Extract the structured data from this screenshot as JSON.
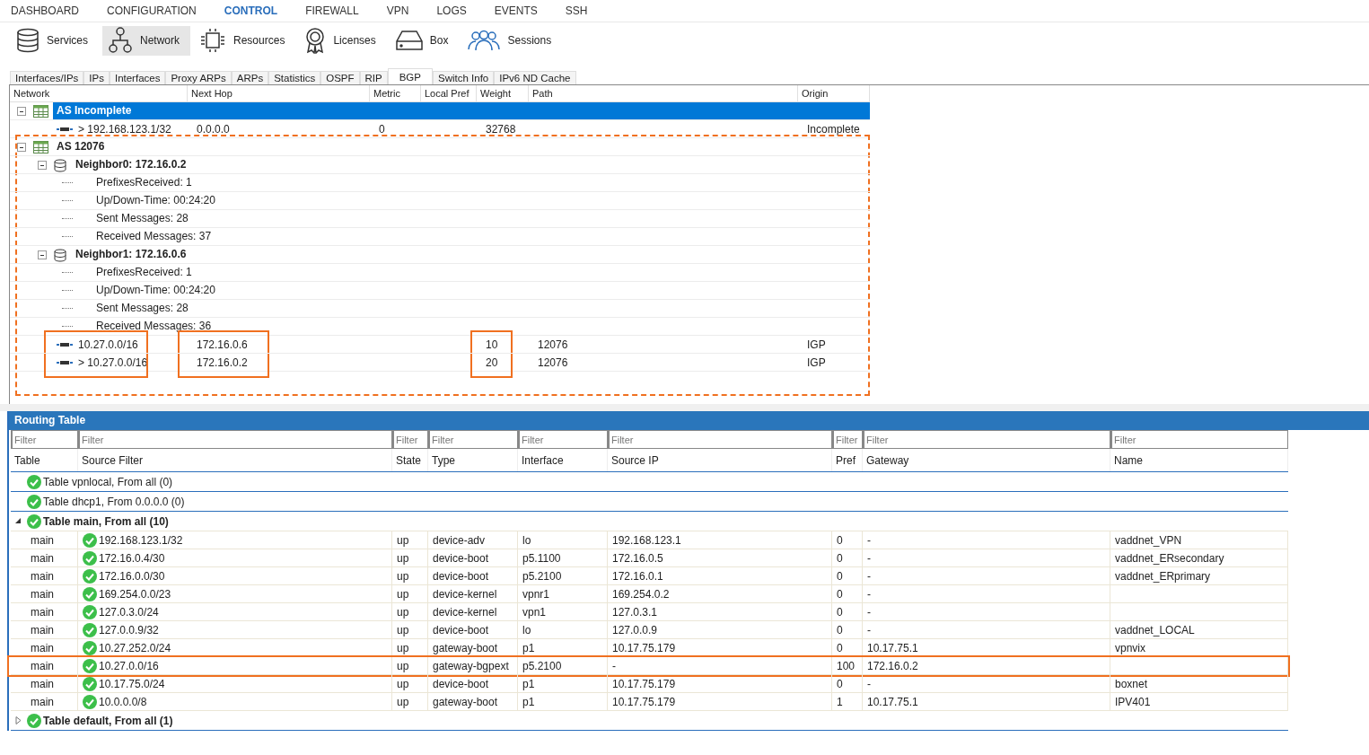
{
  "nav": [
    {
      "label": "DASHBOARD",
      "selected": false
    },
    {
      "label": "CONFIGURATION",
      "selected": false
    },
    {
      "label": "CONTROL",
      "selected": true
    },
    {
      "label": "FIREWALL",
      "selected": false
    },
    {
      "label": "VPN",
      "selected": false
    },
    {
      "label": "LOGS",
      "selected": false
    },
    {
      "label": "EVENTS",
      "selected": false
    },
    {
      "label": "SSH",
      "selected": false
    }
  ],
  "toolbar": [
    {
      "label": "Services",
      "selected": false
    },
    {
      "label": "Network",
      "selected": true
    },
    {
      "label": "Resources",
      "selected": false
    },
    {
      "label": "Licenses",
      "selected": false
    },
    {
      "label": "Box",
      "selected": false
    },
    {
      "label": "Sessions",
      "selected": false
    }
  ],
  "tabs": [
    {
      "label": "Interfaces/IPs",
      "selected": false
    },
    {
      "label": "IPs",
      "selected": false
    },
    {
      "label": "Interfaces",
      "selected": false
    },
    {
      "label": "Proxy ARPs",
      "selected": false
    },
    {
      "label": "ARPs",
      "selected": false
    },
    {
      "label": "Statistics",
      "selected": false
    },
    {
      "label": "OSPF",
      "selected": false
    },
    {
      "label": "RIP",
      "selected": false
    },
    {
      "label": "BGP",
      "selected": true
    },
    {
      "label": "Switch Info",
      "selected": false
    },
    {
      "label": "IPv6 ND Cache",
      "selected": false
    }
  ],
  "bgp": {
    "columns": [
      "Network",
      "Next Hop",
      "Metric",
      "Local Pref",
      "Weight",
      "Path",
      "Origin"
    ],
    "groups": [
      {
        "name": "AS Incomplete",
        "selected": true,
        "expanded": true,
        "highlighted": false,
        "routes": [
          {
            "network": "> 192.168.123.1/32",
            "next_hop": "0.0.0.0",
            "metric": "0",
            "weight": "32768",
            "origin": "Incomplete",
            "network_highlighted": false,
            "next_hop_highlighted": false,
            "weight_highlighted": false
          }
        ]
      },
      {
        "name": "AS 12076",
        "selected": false,
        "expanded": true,
        "highlighted": true,
        "children": [
          {
            "name": "Neighbor0: 172.16.0.2",
            "expanded": true,
            "children": [
              {
                "label": "PrefixesReceived: 1"
              },
              {
                "label": "Up/Down-Time: 00:24:20"
              },
              {
                "label": "Sent Messages: 28"
              },
              {
                "label": "Received Messages: 37"
              }
            ]
          },
          {
            "name": "Neighbor1: 172.16.0.6",
            "expanded": true,
            "children": [
              {
                "label": "PrefixesReceived: 1"
              },
              {
                "label": "Up/Down-Time: 00:24:20"
              },
              {
                "label": "Sent Messages: 28"
              },
              {
                "label": "Received Messages: 36"
              }
            ]
          }
        ],
        "routes": [
          {
            "network": "10.27.0.0/16",
            "next_hop": "172.16.0.6",
            "weight": "10",
            "path": "12076",
            "origin": "IGP",
            "network_highlighted": true,
            "next_hop_highlighted": true,
            "weight_highlighted": true
          },
          {
            "network": "> 10.27.0.0/16",
            "next_hop": "172.16.0.2",
            "weight": "20",
            "path": "12076",
            "origin": "IGP",
            "network_highlighted": true,
            "next_hop_highlighted": true,
            "weight_highlighted": true
          }
        ]
      }
    ]
  },
  "routing": {
    "title": "Routing Table",
    "columns": [
      {
        "label": "Table",
        "placeholder": "Filter"
      },
      {
        "label": "Source Filter",
        "placeholder": "Filter"
      },
      {
        "label": "State",
        "placeholder": "Filter"
      },
      {
        "label": "Type",
        "placeholder": "Filter"
      },
      {
        "label": "Interface",
        "placeholder": "Filter"
      },
      {
        "label": "Source IP",
        "placeholder": "Filter"
      },
      {
        "label": "Pref",
        "placeholder": "Filter"
      },
      {
        "label": "Gateway",
        "placeholder": "Filter"
      },
      {
        "label": "Name",
        "placeholder": "Filter"
      }
    ],
    "groups": [
      {
        "label": "Table vpnlocal, From all (0)"
      },
      {
        "label": "Table dhcp1, From 0.0.0.0 (0)"
      },
      {
        "label": "Table main, From all (10)",
        "expanded": true,
        "rows": [
          {
            "table": "main",
            "source_filter": "192.168.123.1/32",
            "state": "up",
            "type": "device-adv",
            "interface": "lo",
            "source_ip": "192.168.123.1",
            "pref": "0",
            "gateway": "-",
            "name": "vaddnet_VPN",
            "highlighted": false
          },
          {
            "table": "main",
            "source_filter": "172.16.0.4/30",
            "state": "up",
            "type": "device-boot",
            "interface": "p5.1100",
            "source_ip": "172.16.0.5",
            "pref": "0",
            "gateway": "-",
            "name": "vaddnet_ERsecondary",
            "highlighted": false
          },
          {
            "table": "main",
            "source_filter": "172.16.0.0/30",
            "state": "up",
            "type": "device-boot",
            "interface": "p5.2100",
            "source_ip": "172.16.0.1",
            "pref": "0",
            "gateway": "-",
            "name": "vaddnet_ERprimary",
            "highlighted": false
          },
          {
            "table": "main",
            "source_filter": "169.254.0.0/23",
            "state": "up",
            "type": "device-kernel",
            "interface": "vpnr1",
            "source_ip": "169.254.0.2",
            "pref": "0",
            "gateway": "-",
            "highlighted": false
          },
          {
            "table": "main",
            "source_filter": "127.0.3.0/24",
            "state": "up",
            "type": "device-kernel",
            "interface": "vpn1",
            "source_ip": "127.0.3.1",
            "pref": "0",
            "gateway": "-",
            "highlighted": false
          },
          {
            "table": "main",
            "source_filter": "127.0.0.9/32",
            "state": "up",
            "type": "device-boot",
            "interface": "lo",
            "source_ip": "127.0.0.9",
            "pref": "0",
            "gateway": "-",
            "name": "vaddnet_LOCAL",
            "highlighted": false
          },
          {
            "table": "main",
            "source_filter": "10.27.252.0/24",
            "state": "up",
            "type": "gateway-boot",
            "interface": "p1",
            "source_ip": "10.17.75.179",
            "pref": "0",
            "gateway": "10.17.75.1",
            "name": "vpnvix",
            "highlighted": false
          },
          {
            "table": "main",
            "source_filter": "10.27.0.0/16",
            "state": "up",
            "type": "gateway-bgpext",
            "interface": "p5.2100",
            "source_ip": "-",
            "pref": "100",
            "gateway": "172.16.0.2",
            "highlighted": true
          },
          {
            "table": "main",
            "source_filter": "10.17.75.0/24",
            "state": "up",
            "type": "device-boot",
            "interface": "p1",
            "source_ip": "10.17.75.179",
            "pref": "0",
            "gateway": "-",
            "name": "boxnet",
            "highlighted": false
          },
          {
            "table": "main",
            "source_filter": "10.0.0.0/8",
            "state": "up",
            "type": "gateway-boot",
            "interface": "p1",
            "source_ip": "10.17.75.179",
            "pref": "1",
            "gateway": "10.17.75.1",
            "name": "IPV401",
            "highlighted": false
          }
        ]
      },
      {
        "label": "Table default, From all (1)",
        "expanded": false
      }
    ]
  }
}
